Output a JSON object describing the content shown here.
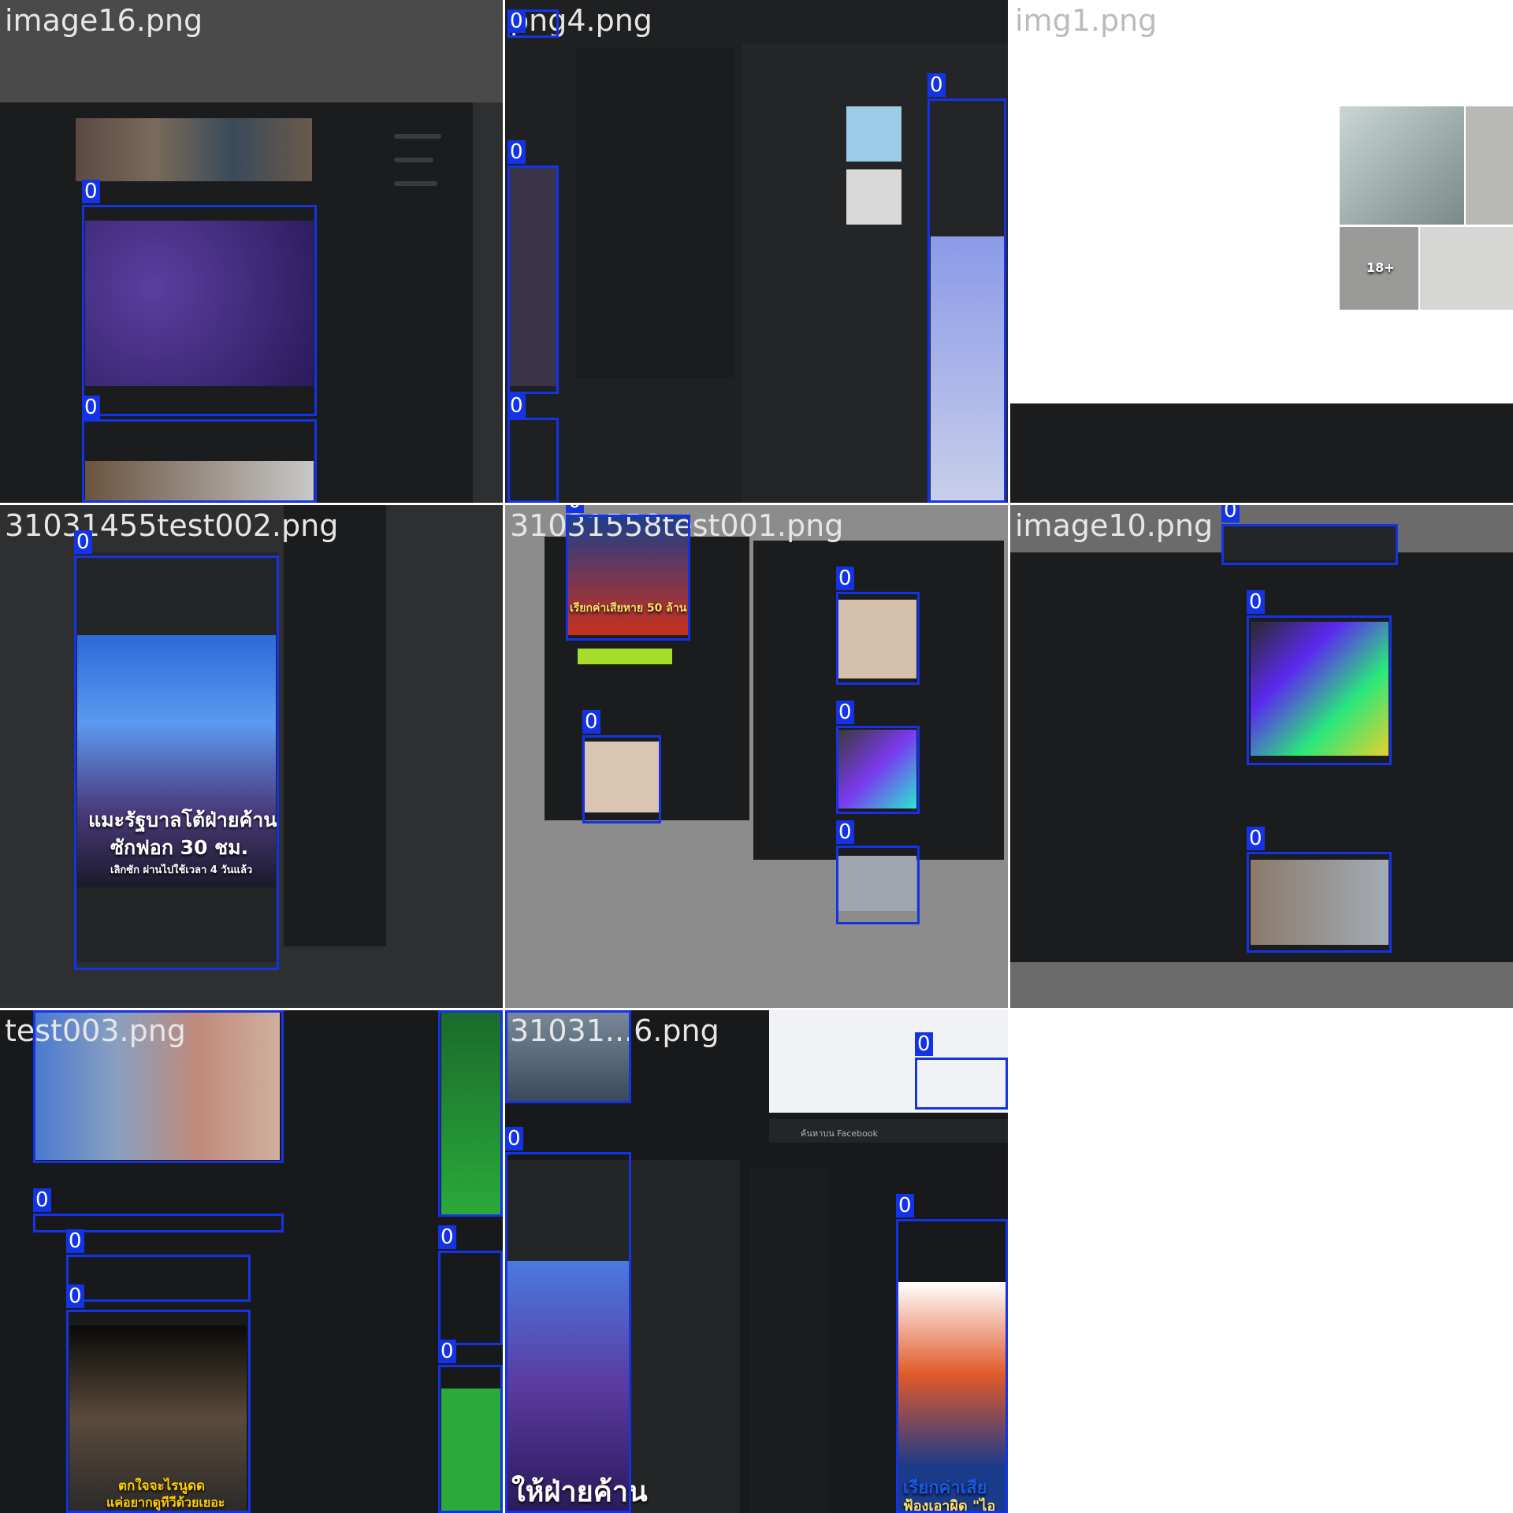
{
  "grid": {
    "tiles": [
      {
        "label": "image16.png"
      },
      {
        "label": "png4.png"
      },
      {
        "label": "img1.png"
      },
      {
        "label": "31031455test002.png"
      },
      {
        "label": "31031558test001.png"
      },
      {
        "label": "image10.png"
      },
      {
        "label": "test003.png"
      },
      {
        "label": "31031...6.png"
      }
    ],
    "detection_tag": "0"
  },
  "tile_text": {
    "img1_count": "18+",
    "test002_caption_1": "แมะรัฐบาลโต้ฝ่ายค้าน",
    "test002_caption_2": "ซักฟอก 30 ชม.",
    "test002_caption_3": "เลิกซัก ผ่านไปใช้เวลา 4 วันแล้ว",
    "test001_caption_1": "เรียกค่าเสียหาย 50 ล้าน",
    "test003_caption_1": "ตกใจจะไรนูดด",
    "test003_caption_2": "แค่อยากดูทีวีด้วยเยอะ",
    "t8_caption_1": "ให้ฝ่ายค้าน",
    "t8_caption_2": "เรียกค่าเสีย",
    "t8_caption_3": "ฟ้องเอาผิด \"ไอ",
    "t8_search": "ค้นหาบน Facebook"
  },
  "colors": {
    "detection_box": "#1533e6",
    "fb_dark_bg": "#18191a",
    "fb_panel": "#242526",
    "fb_blue": "#2d88ff"
  }
}
